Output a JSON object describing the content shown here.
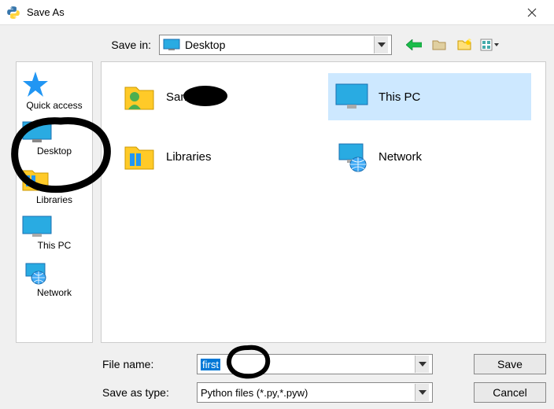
{
  "titlebar": {
    "title": "Save As"
  },
  "savein": {
    "label": "Save in:",
    "value": "Desktop"
  },
  "tools": {
    "back": "back-arrow",
    "recent": "recent-folder",
    "up": "new-folder",
    "view": "view-menu"
  },
  "places": [
    {
      "id": "quick-access",
      "label": "Quick access"
    },
    {
      "id": "desktop",
      "label": "Desktop",
      "selected": true
    },
    {
      "id": "libraries",
      "label": "Libraries"
    },
    {
      "id": "this-pc",
      "label": "This PC"
    },
    {
      "id": "network",
      "label": "Network"
    }
  ],
  "files": [
    {
      "id": "sam",
      "label": "Sam",
      "icon": "user-folder"
    },
    {
      "id": "this-pc",
      "label": "This PC",
      "icon": "monitor",
      "selected": true
    },
    {
      "id": "libraries",
      "label": "Libraries",
      "icon": "libraries-folder"
    },
    {
      "id": "network",
      "label": "Network",
      "icon": "network-monitor"
    }
  ],
  "filename": {
    "label": "File name:",
    "value": "first"
  },
  "filetype": {
    "label": "Save as type:",
    "value": "Python files (*.py,*.pyw)"
  },
  "buttons": {
    "save": "Save",
    "cancel": "Cancel"
  }
}
